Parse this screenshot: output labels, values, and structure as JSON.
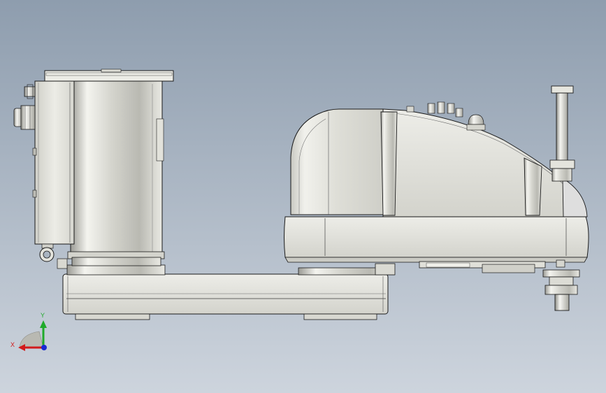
{
  "viewport": {
    "background_top": "#8e9dae",
    "background_bottom": "#cdd4dd"
  },
  "model": {
    "parts": [
      "motor-housing",
      "connector-box",
      "lower-arm",
      "upper-arm-housing",
      "ball-screw-spline",
      "tool-flange"
    ],
    "body_color": "#e6e6df",
    "edge_color": "#1a1a1a"
  },
  "triad": {
    "x_label": "X",
    "y_label": "Y",
    "x_color": "#d21a1a",
    "y_color": "#1faa2a",
    "z_color": "#1a2ad2"
  }
}
